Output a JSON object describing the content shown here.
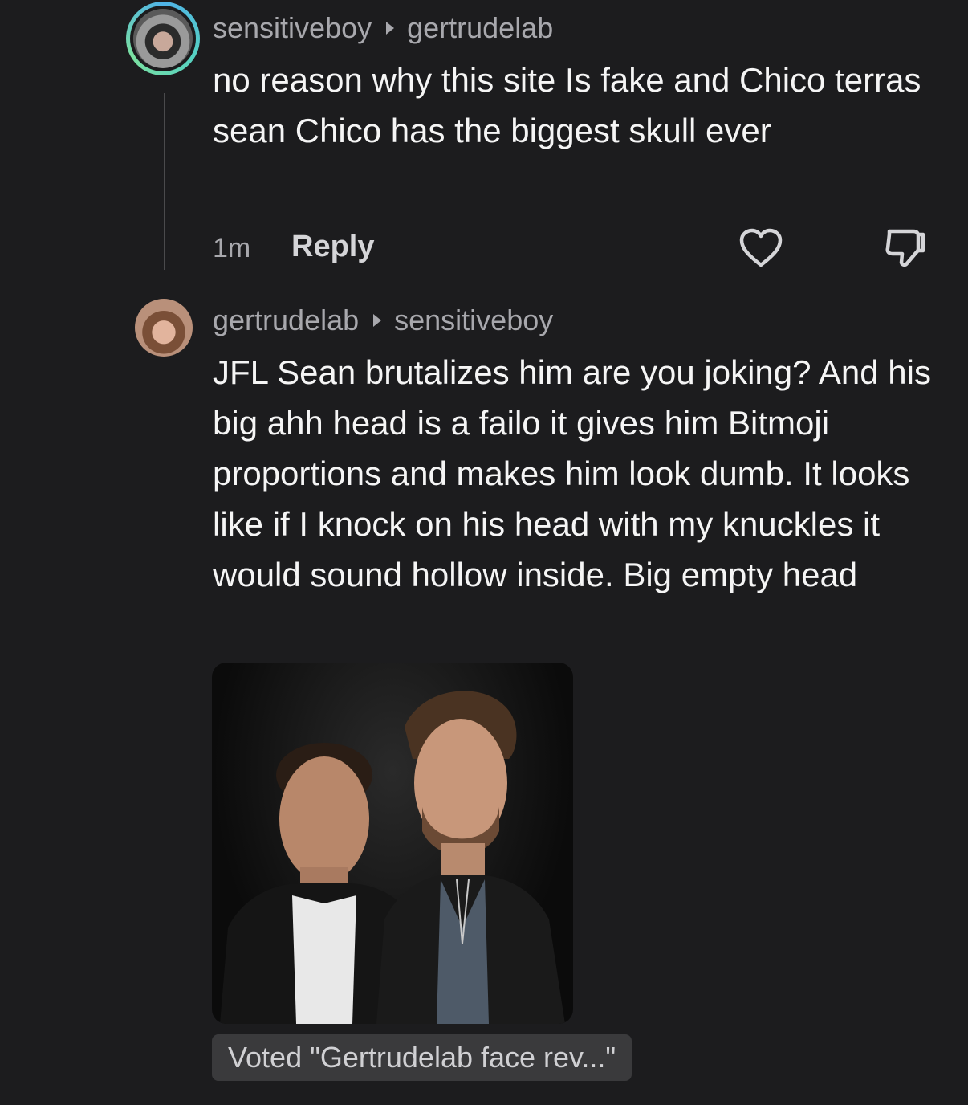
{
  "comments": [
    {
      "author": "sensitiveboy",
      "reply_to": "gertrudelab",
      "text": "no reason why this site Is fake and Chico terras sean Chico has the biggest skull ever",
      "time": "1m",
      "reply_label": "Reply"
    },
    {
      "author": "gertrudelab",
      "reply_to": "sensitiveboy",
      "text": "JFL Sean brutalizes him are you joking? And his big ahh head is a failo it gives him Bitmoji proportions and makes him look dumb. It looks like if I knock on his head with my knuckles it would sound hollow inside. Big empty head",
      "vote_label": "Voted \"Gertrudelab face rev...\""
    }
  ],
  "icons": {
    "like": "heart-icon",
    "dislike": "thumbs-down-icon",
    "separator": "triangle-right-icon"
  },
  "colors": {
    "background": "#1c1c1e",
    "text": "#f5f5f5",
    "muted": "#a8a8ad",
    "chip": "#3a3a3c"
  }
}
